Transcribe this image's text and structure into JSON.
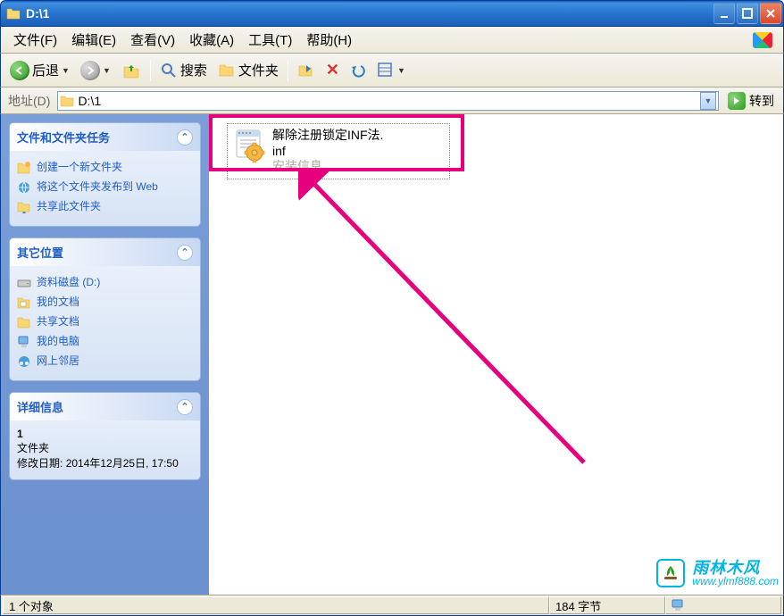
{
  "window": {
    "title": "D:\\1"
  },
  "menu": {
    "file": "文件(F)",
    "edit": "编辑(E)",
    "view": "查看(V)",
    "favorites": "收藏(A)",
    "tools": "工具(T)",
    "help": "帮助(H)"
  },
  "toolbar": {
    "back": "后退",
    "search": "搜索",
    "folders": "文件夹"
  },
  "address": {
    "label": "地址(D)",
    "value": "D:\\1",
    "go": "转到"
  },
  "sidebar": {
    "tasks": {
      "title": "文件和文件夹任务",
      "items": [
        "创建一个新文件夹",
        "将这个文件夹发布到 Web",
        "共享此文件夹"
      ]
    },
    "other": {
      "title": "其它位置",
      "items": [
        "资料磁盘 (D:)",
        "我的文档",
        "共享文档",
        "我的电脑",
        "网上邻居"
      ]
    },
    "details": {
      "title": "详细信息",
      "name": "1",
      "type": "文件夹",
      "date_label": "修改日期:",
      "date_value": "2014年12月25日, 17:50"
    }
  },
  "file": {
    "name_line1": "解除注册锁定INF法.",
    "name_line2": "inf",
    "desc": "安装信息"
  },
  "statusbar": {
    "count": "1 个对象",
    "size": "184 字节"
  },
  "watermark": {
    "brand": "雨林木风",
    "url": "www.ylmf888.com"
  }
}
